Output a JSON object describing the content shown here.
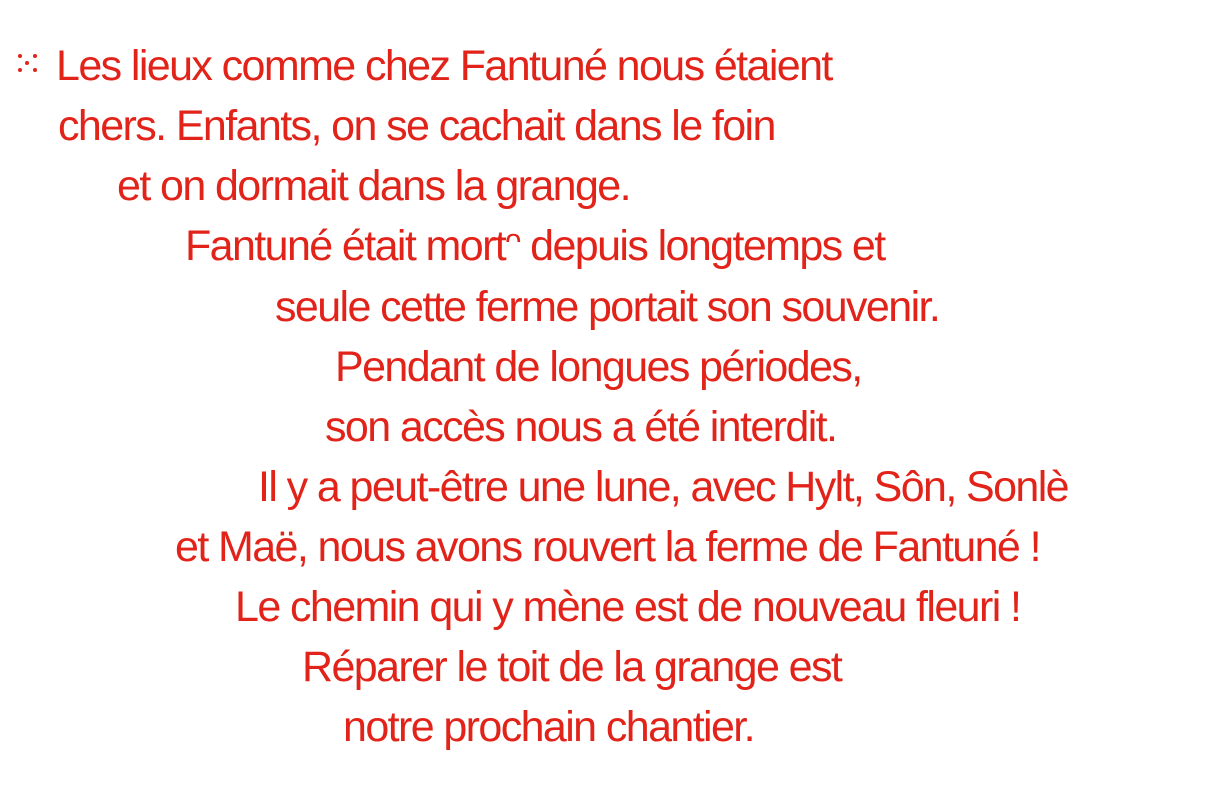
{
  "colors": {
    "text": "#e2231a",
    "background": "#ffffff"
  },
  "bullet_icon": "five-dot-bullet-icon",
  "poem": {
    "lines": [
      "Les lieux comme chez Fantuné nous étaient",
      "chers. Enfants, on se cachait dans le foin",
      "et on dormait dans la grange.",
      "Fantuné était mortᵔ depuis longtemps et",
      "seule cette ferme portait son souvenir.",
      "Pendant de longues périodes,",
      "son accès nous a été interdit.",
      "Il y a peut-être une lune, avec Hylt, Sôn, Sonlè",
      "et Maë, nous avons rouvert la ferme de Fantuné !",
      "Le chemin qui y mène est de nouveau fleuri !",
      "Réparer le toit de la grange est",
      "notre prochain chantier."
    ]
  }
}
